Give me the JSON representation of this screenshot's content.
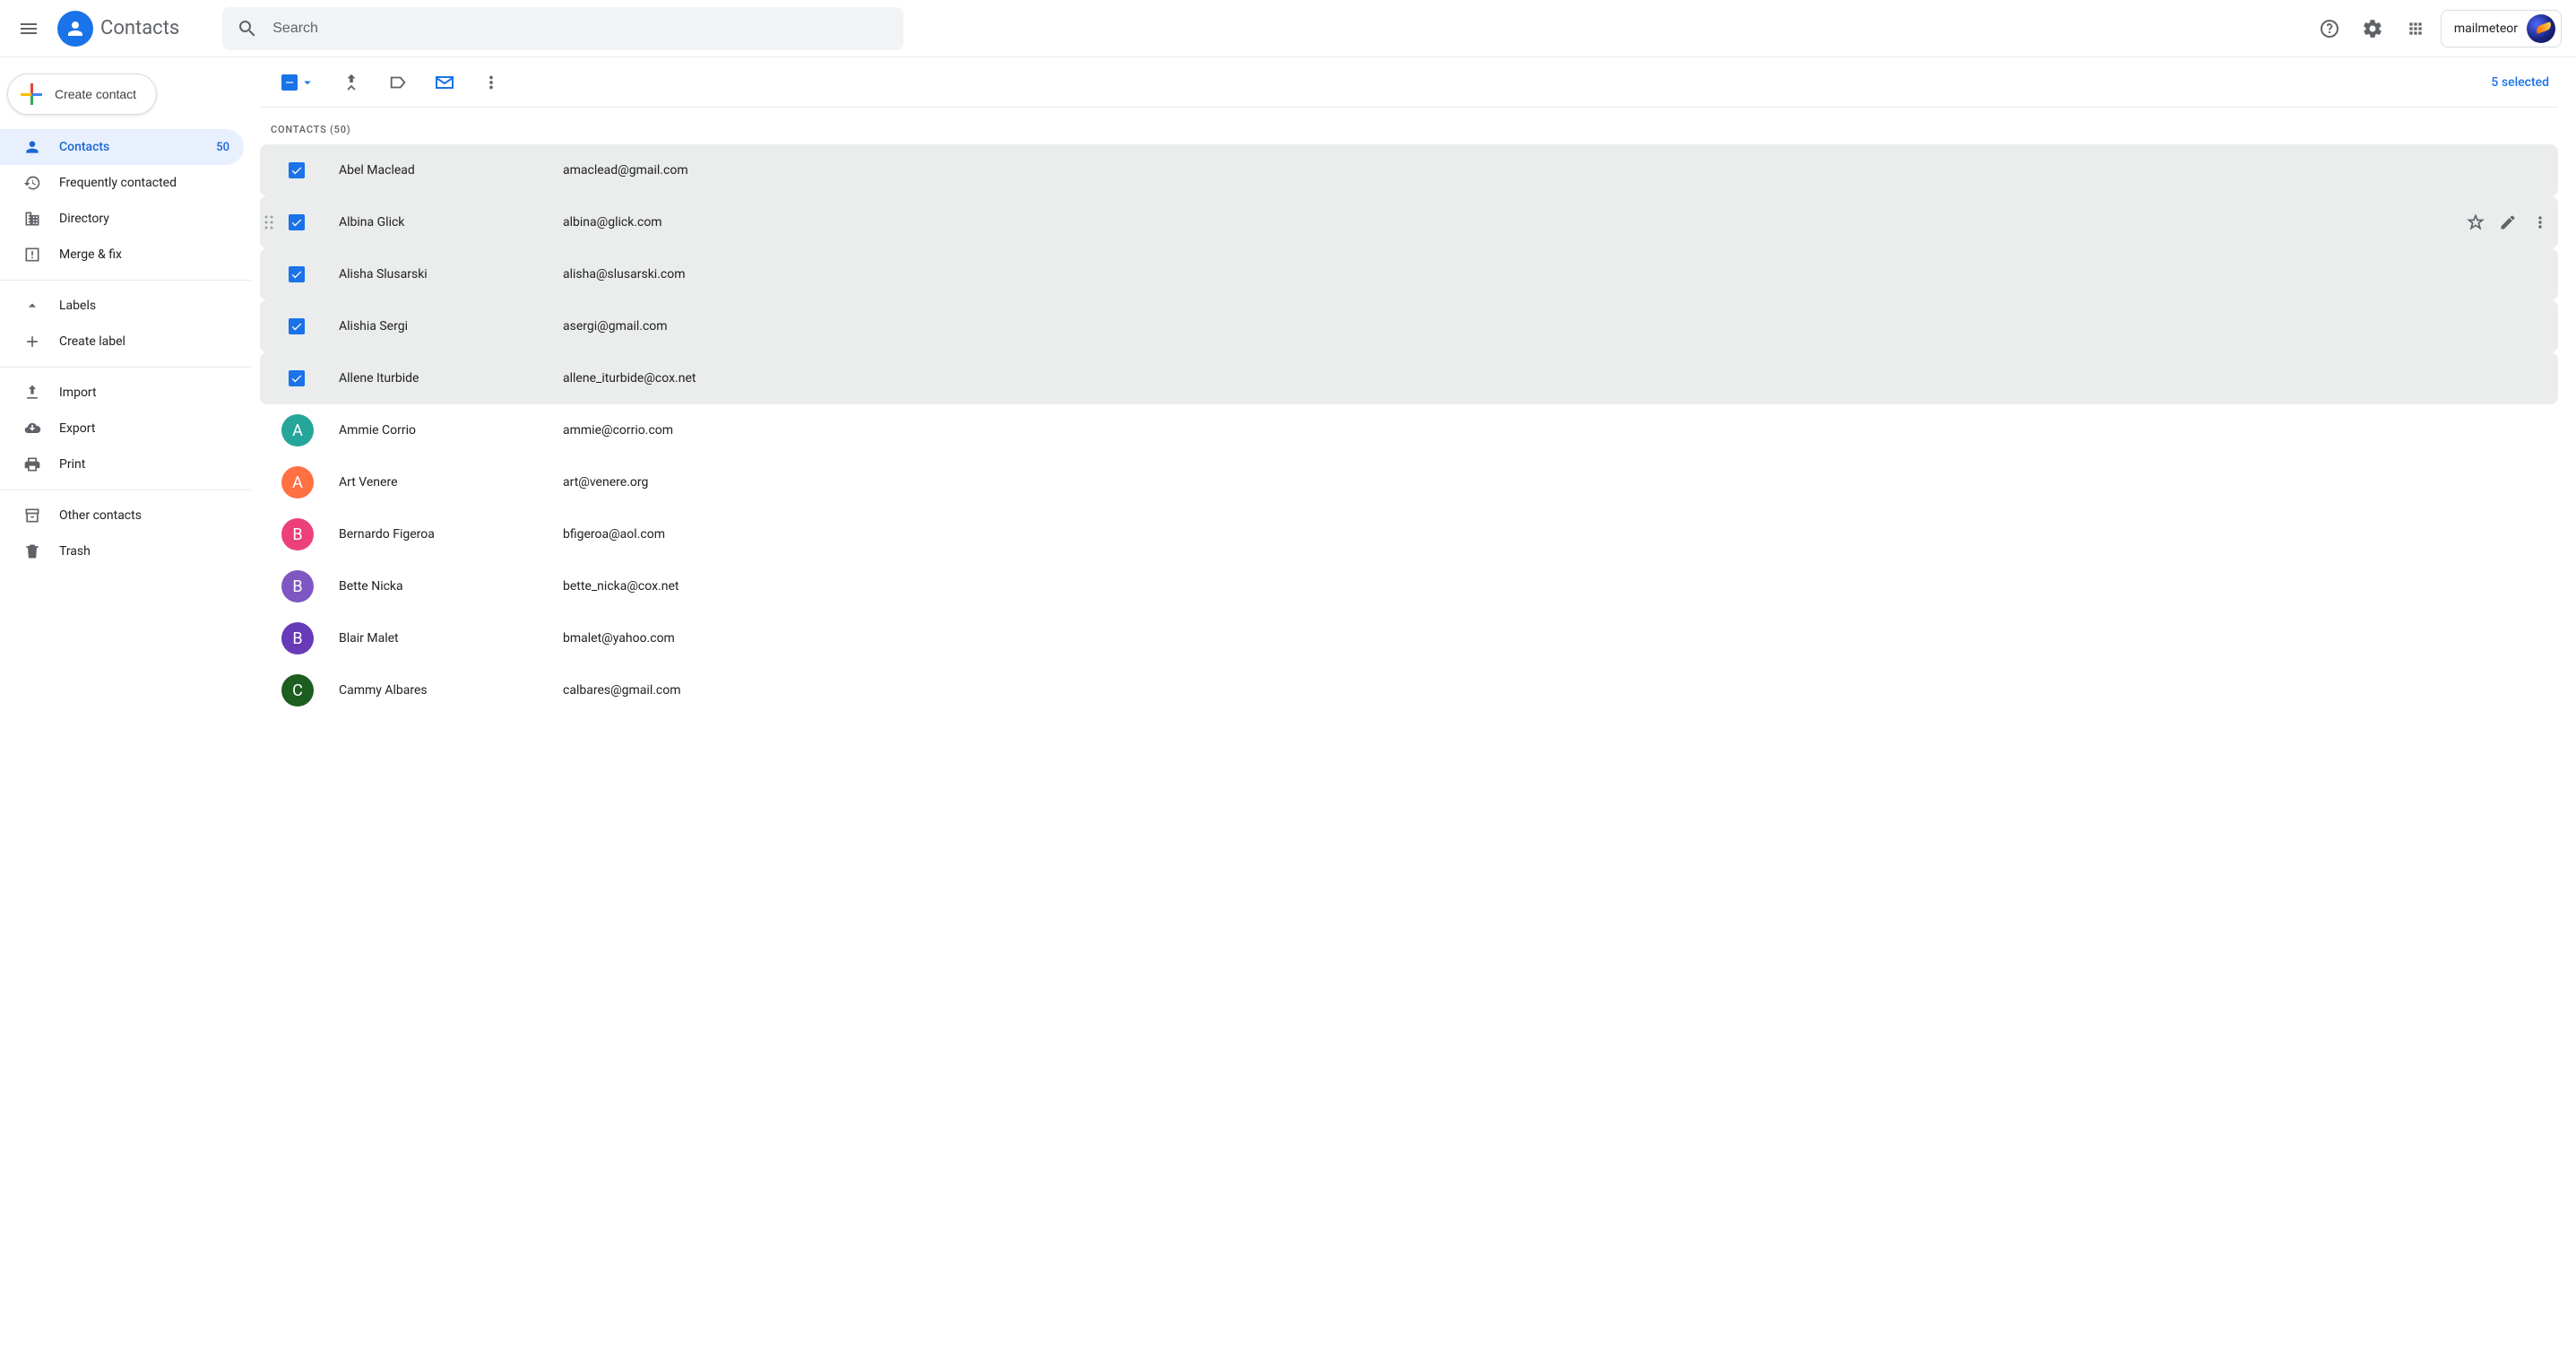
{
  "header": {
    "app_title": "Contacts",
    "search_placeholder": "Search",
    "account_label": "mailmeteor"
  },
  "sidebar": {
    "create_label": "Create contact",
    "items_main": [
      {
        "label": "Contacts",
        "count": "50",
        "icon": "person",
        "active": true
      },
      {
        "label": "Frequently contacted",
        "icon": "history"
      },
      {
        "label": "Directory",
        "icon": "domain"
      },
      {
        "label": "Merge & fix",
        "icon": "merge-fix"
      }
    ],
    "labels_header": "Labels",
    "create_label_text": "Create label",
    "items_io": [
      {
        "label": "Import",
        "icon": "upload"
      },
      {
        "label": "Export",
        "icon": "cloud-download"
      },
      {
        "label": "Print",
        "icon": "print"
      }
    ],
    "items_other": [
      {
        "label": "Other contacts",
        "icon": "archive"
      },
      {
        "label": "Trash",
        "icon": "trash"
      }
    ]
  },
  "toolbar": {
    "selected_text": "5 selected"
  },
  "list": {
    "section_header": "CONTACTS (50)",
    "contacts": [
      {
        "name": "Abel Maclead",
        "email": "amaclead@gmail.com",
        "selected": true
      },
      {
        "name": "Albina Glick",
        "email": "albina@glick.com",
        "selected": true,
        "hovered": true
      },
      {
        "name": "Alisha Slusarski",
        "email": "alisha@slusarski.com",
        "selected": true
      },
      {
        "name": "Alishia Sergi",
        "email": "asergi@gmail.com",
        "selected": true
      },
      {
        "name": "Allene Iturbide",
        "email": "allene_iturbide@cox.net",
        "selected": true
      },
      {
        "name": "Ammie Corrio",
        "email": "ammie@corrio.com",
        "avatar": "A",
        "color": "c-teal"
      },
      {
        "name": "Art Venere",
        "email": "art@venere.org",
        "avatar": "A",
        "color": "c-orange"
      },
      {
        "name": "Bernardo Figeroa",
        "email": "bfigeroa@aol.com",
        "avatar": "B",
        "color": "c-pink"
      },
      {
        "name": "Bette Nicka",
        "email": "bette_nicka@cox.net",
        "avatar": "B",
        "color": "c-purple"
      },
      {
        "name": "Blair Malet",
        "email": "bmalet@yahoo.com",
        "avatar": "B",
        "color": "c-dpurple"
      },
      {
        "name": "Cammy Albares",
        "email": "calbares@gmail.com",
        "avatar": "C",
        "color": "c-green"
      }
    ]
  }
}
